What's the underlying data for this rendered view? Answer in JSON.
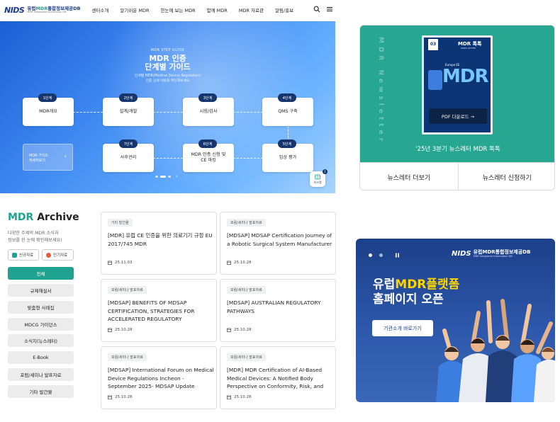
{
  "header": {
    "logo_mark": "NIDS",
    "logo_title_part1": "유럽",
    "logo_title_accent": "MDR",
    "logo_title_part2": "통합정보제공DB",
    "logo_subtitle": "MDR Integrated Information DB",
    "nav": [
      "센터소개",
      "알기쉬운 MDR",
      "한눈에 보는 MDR",
      "함께 MDR",
      "MDR 자료관",
      "알림/홍보"
    ]
  },
  "hero": {
    "kicker": "MDR STEP GUIDE",
    "title_line1": "MDR 인증",
    "title_line2": "단계별 가이드",
    "desc_line1": "단계별 MDR(Medical Device Regulation)",
    "desc_line2": "인증 상세 내용을 확인해보세요",
    "steps": [
      {
        "badge": "1단계",
        "label": "MDR개요"
      },
      {
        "badge": "2단계",
        "label": "설계/개발"
      },
      {
        "badge": "3단계",
        "label": "시험/검사"
      },
      {
        "badge": "4단계",
        "label": "QMS 구축"
      },
      {
        "badge": "5단계",
        "label": "임상 평가"
      },
      {
        "badge": "6단계",
        "label": "MDR 인증 신청 및 CE 마킹"
      },
      {
        "badge": "7단계",
        "label": "사후관리"
      }
    ],
    "guide_line1": "MDR 가이드",
    "guide_line2": "자세히보기",
    "guide_arrow": "›",
    "pager_arrow": "›",
    "tour_label": "워크맵",
    "tour_badge": "1"
  },
  "newsletter": {
    "vertical_text": "MDR Newsletter",
    "magazine_title": "MDR 톡톡",
    "magazine_subtitle": "MDRS LETTER",
    "magazine_number": "03",
    "magazine_tag": "Europe EE",
    "magazine_big": "MDR",
    "pdf_button": "PDF 다운로드 →",
    "caption": "'25년 3분기 뉴스레터 MDR 톡톡",
    "btn_more": "뉴스레터 더보기",
    "btn_subscribe": "뉴스레터 신청하기"
  },
  "archive": {
    "title_accent": "MDR",
    "title_rest": " Archive",
    "desc_line1": "다양한 주제의 MDR 소식과",
    "desc_line2": "정보를 한 눈에 확인해보세요!",
    "tab_new": "신규자료",
    "tab_popular": "인기자료",
    "categories": [
      "전체",
      "규제해설서",
      "맞춤형 사례집",
      "MDCG 가이던스",
      "소식지(뉴스레터)",
      "E-Book",
      "포럼/세미나 발표자료",
      "기타 발간물"
    ],
    "cards": [
      {
        "tag": "기타 발간물",
        "title": "[MDR] 유럽 CE 인증을 위한 의료기기 규정 EU 2017/745 MDR",
        "date": "25.11.03"
      },
      {
        "tag": "포럼/세미나 발표자료",
        "title": "[MDSAP] MDSAP Certification Journey of a Robotic Surgical System Manufacturer",
        "date": "25.10.28"
      },
      {
        "tag": "포럼/세미나 발표자료",
        "title": "[MDSAP] BENEFITS OF MDSAP CERTIFICATION, STRATEGIES FOR ACCELERATED REGULATORY",
        "date": "25.10.28"
      },
      {
        "tag": "포럼/세미나 발표자료",
        "title": "[MDSAP] AUSTRALIAN REGULATORY PATHWAYS",
        "date": "25.10.28"
      },
      {
        "tag": "포럼/세미나 발표자료",
        "title": "[MDSAP] International Forum on Medical Device Regulations Incheon - September 2025- MDSAP Update",
        "date": "25.10.28"
      },
      {
        "tag": "포럼/세미나 발표자료",
        "title": "[MDR] MDR Certification of AI-Based Medical Devices: A Notified Body Perspective on Conformity, Risk, and",
        "date": "25.10.28"
      }
    ]
  },
  "banner": {
    "logo_mark": "NIDS",
    "logo_title": "유럽MDR통합정보제공DB",
    "logo_subtitle": "MDR Integrated Information DB",
    "headline1_pre": "유럽",
    "headline1_accent": "MDR플랫폼",
    "headline2": "홈페이지 오픈",
    "button": "기관소개 바로가기"
  },
  "colors": {
    "accent_teal": "#1fa28f",
    "navy": "#16356c",
    "newsletter_bg": "#27a792",
    "banner_bg": "#2d58ab",
    "highlight_yellow": "#ffd400"
  }
}
